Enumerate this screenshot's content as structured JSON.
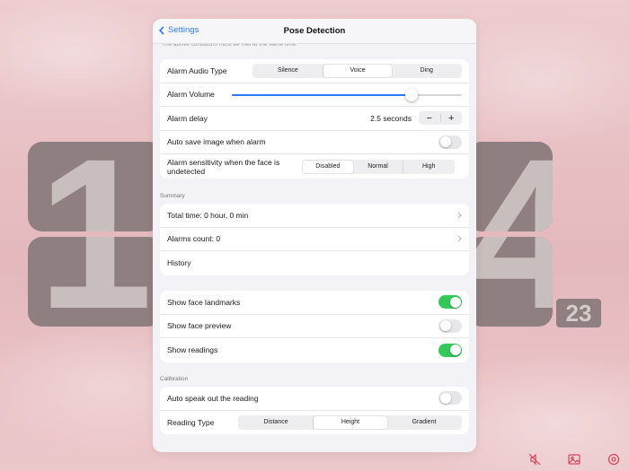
{
  "clock": {
    "hour_digit": "1",
    "minute_digit": "4",
    "seconds": "23"
  },
  "nav": {
    "back_label": "Settings",
    "title": "Pose Detection"
  },
  "scroll_cut_text": "The above conditions must be met at the same time.",
  "alarm": {
    "audio_type": {
      "label": "Alarm Audio Type",
      "options": [
        "Silence",
        "Voice",
        "Ding"
      ],
      "selected": "Voice"
    },
    "volume": {
      "label": "Alarm Volume",
      "value": 0.78
    },
    "delay": {
      "label": "Alarm delay",
      "value": "2.5 seconds",
      "minus": "−",
      "plus": "+"
    },
    "auto_save": {
      "label": "Auto save image when alarm",
      "on": false
    },
    "sensitivity": {
      "label": "Alarm sensitivity when the face is undetected",
      "options": [
        "Disabled",
        "Normal",
        "High"
      ],
      "selected": "Disabled"
    }
  },
  "summary": {
    "header": "Summary",
    "total_time": "Total time: 0 hour, 0 min",
    "alarms_count": "Alarms count: 0",
    "history": "History"
  },
  "display": {
    "landmarks": {
      "label": "Show face landmarks",
      "on": true
    },
    "preview": {
      "label": "Show face preview",
      "on": false
    },
    "readings": {
      "label": "Show readings",
      "on": true
    }
  },
  "calibration": {
    "header": "Calibration",
    "auto_speak": {
      "label": "Auto speak out the reading",
      "on": false
    },
    "reading_type": {
      "label": "Reading Type",
      "options": [
        "Distance",
        "Height",
        "Gradient"
      ],
      "selected": "Height"
    }
  },
  "colors": {
    "accent": "#2f7bf6",
    "toggle_on": "#34c759",
    "icon_red": "#d1475a"
  },
  "icons": [
    "chevron-left-icon",
    "chevron-right-icon",
    "mute-icon",
    "photo-icon",
    "gear-icon"
  ]
}
